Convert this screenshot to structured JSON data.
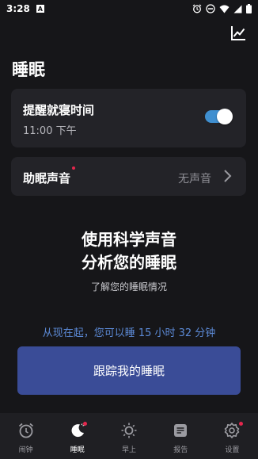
{
  "status": {
    "time": "3:28",
    "badge": "A"
  },
  "page": {
    "title": "睡眠"
  },
  "reminder": {
    "label": "提醒就寝时间",
    "time": "11:00 下午",
    "enabled": true
  },
  "sound": {
    "label": "助眠声音",
    "value": "无声音"
  },
  "promo": {
    "headline_line1": "使用科学声音",
    "headline_line2": "分析您的睡眠",
    "subtitle": "了解您的睡眠情况"
  },
  "sleep_info": "从现在起，您可以睡 15 小时 32 分钟",
  "track_button": "跟踪我的睡眠",
  "colors": {
    "accent": "#3a4c97",
    "toggle": "#3f8fd0",
    "link_text": "#5c8ad6",
    "dot": "#e5274d"
  },
  "nav": [
    {
      "label": "闹钟",
      "icon": "alarm-clock-icon",
      "active": false,
      "dot": false
    },
    {
      "label": "睡眠",
      "icon": "moon-icon",
      "active": true,
      "dot": true
    },
    {
      "label": "早上",
      "icon": "sun-icon",
      "active": false,
      "dot": false
    },
    {
      "label": "报告",
      "icon": "report-icon",
      "active": false,
      "dot": false
    },
    {
      "label": "设置",
      "icon": "gear-icon",
      "active": false,
      "dot": true
    }
  ]
}
